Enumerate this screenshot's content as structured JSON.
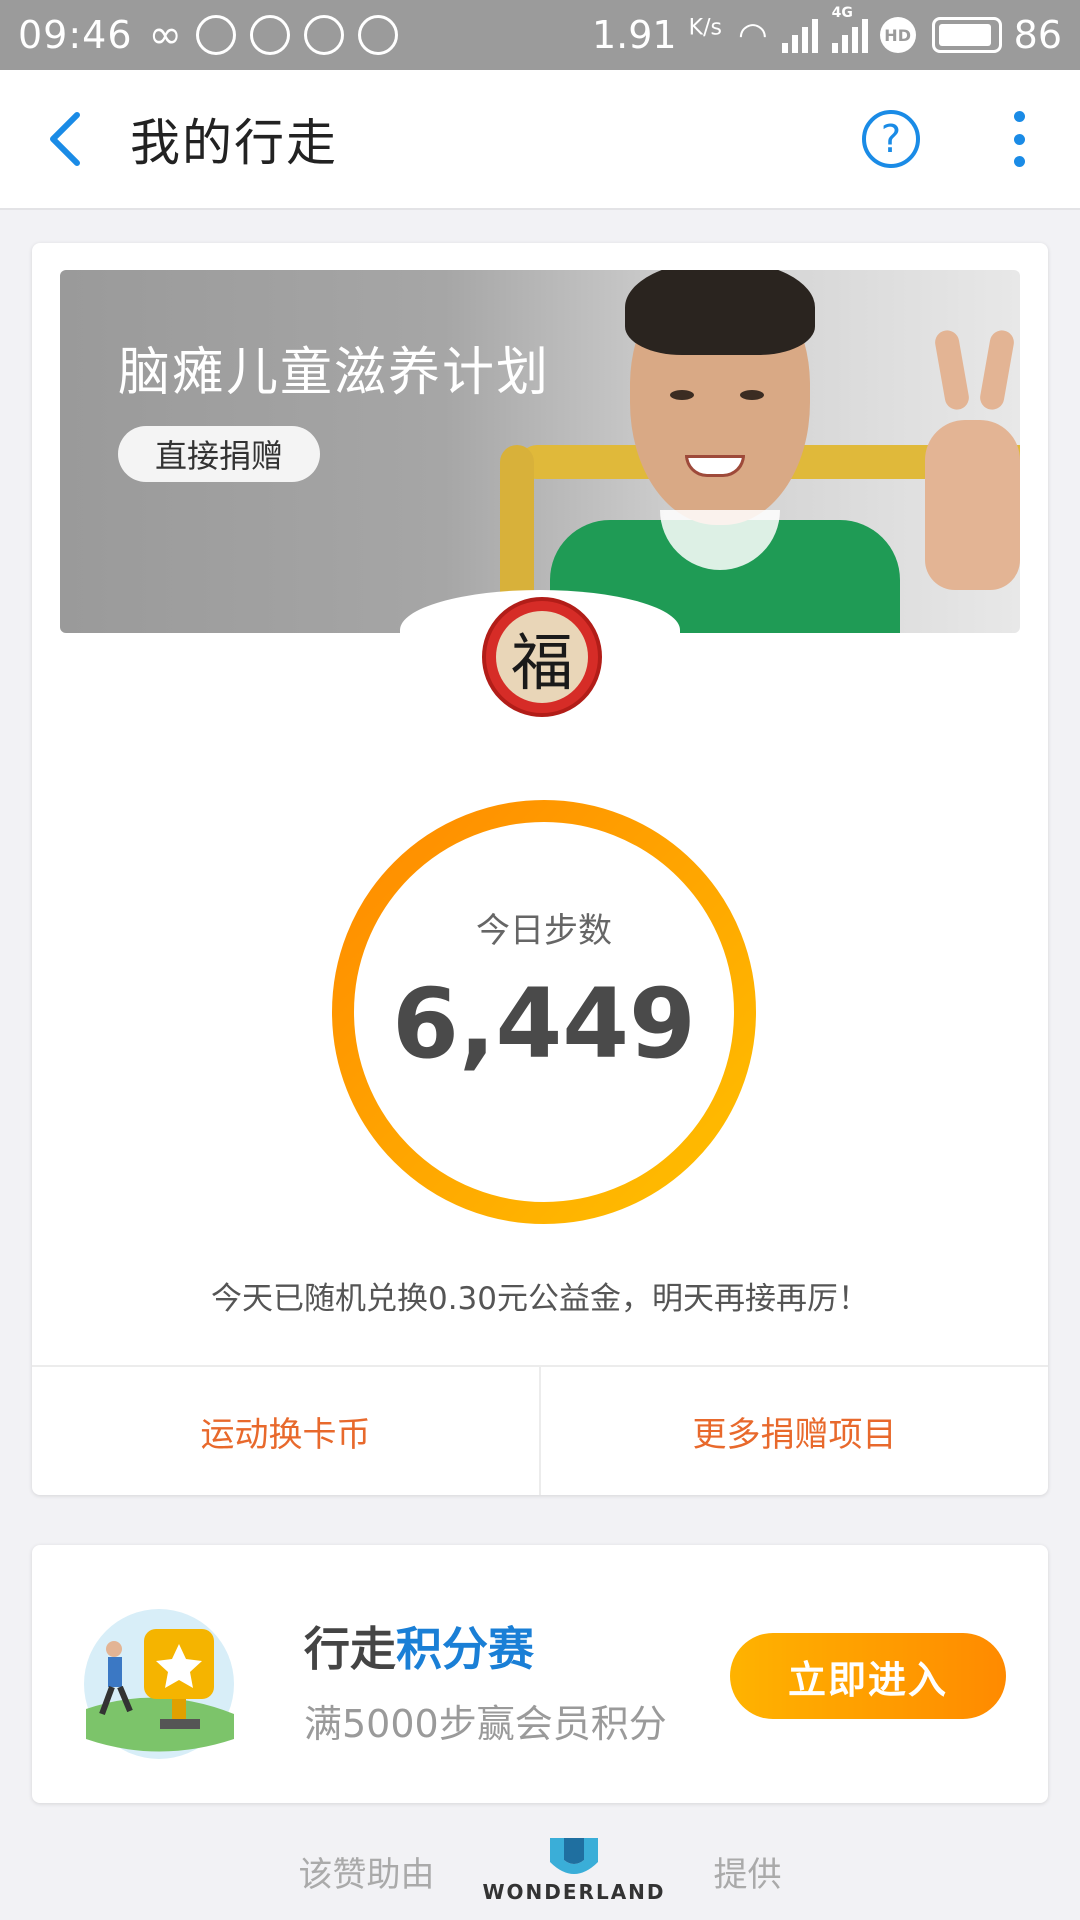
{
  "status_bar": {
    "time": "09:46",
    "net_speed": "1.91",
    "net_unit": "K/s",
    "network_type": "4G",
    "hd_label": "HD",
    "battery": "86"
  },
  "header": {
    "title": "我的行走"
  },
  "banner": {
    "title": "脑瘫儿童滋养计划",
    "donate_label": "直接捐赠",
    "badge_char": "福"
  },
  "steps": {
    "label": "今日步数",
    "value": "6,449"
  },
  "message": "今天已随机兑换0.30元公益金，明天再接再厉！",
  "actions": {
    "left": "运动换卡币",
    "right": "更多捐赠项目"
  },
  "competition": {
    "title_prefix": "行走",
    "title_highlight": "积分赛",
    "subtitle": "满5000步赢会员积分",
    "button": "立即进入"
  },
  "footer": {
    "left": "该赞助由",
    "brand": "WONDERLAND",
    "right": "提供"
  },
  "colors": {
    "accent_blue": "#1a8be6",
    "action_orange": "#e8692c",
    "ring_start": "#ff8a00",
    "ring_end": "#ffc000"
  }
}
